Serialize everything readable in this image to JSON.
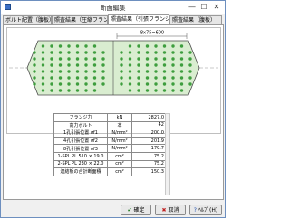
{
  "window": {
    "title": "断面編集",
    "minimize": "—",
    "maximize": "☐",
    "close": "✕"
  },
  "tabs": [
    {
      "label": "ボルト配置（腹板）"
    },
    {
      "label": "照査結果（圧縮フランジ）"
    },
    {
      "label": "照査結果（引張フランジ）"
    },
    {
      "label": "照査結果（腹板）"
    }
  ],
  "drawing": {
    "dimension_label": "8x75=600"
  },
  "table": {
    "rows": [
      {
        "name": "フランジ力",
        "unit": "kN",
        "value": "2827.0"
      },
      {
        "name": "高力ボルト",
        "unit": "本",
        "value": "42"
      },
      {
        "name": "1孔引張位置 σf1",
        "unit": "N/mm²",
        "value": "200.0"
      },
      {
        "name": "4孔引張位置 σf2",
        "unit": "N/mm²",
        "value": "201.9"
      },
      {
        "name": "8孔引張位置 σf3",
        "unit": "N/mm²",
        "value": "179.7"
      },
      {
        "name": "1-SPL PL 510 × 19.0",
        "unit": "cm²",
        "value": "75.2"
      },
      {
        "name": "2-SPL PL 230 × 22.0",
        "unit": "cm²",
        "value": "75.2"
      },
      {
        "name": "連結板の合計断面積",
        "unit": "cm²",
        "value": "150.3"
      }
    ]
  },
  "buttons": {
    "ok": "確定",
    "cancel": "取消",
    "help": "ﾍﾙﾌﾟ(H)"
  },
  "colors": {
    "plate_fill": "#d9edd0",
    "bolt": "#3e9e3e",
    "plate_edge": "#4a4a4a"
  }
}
